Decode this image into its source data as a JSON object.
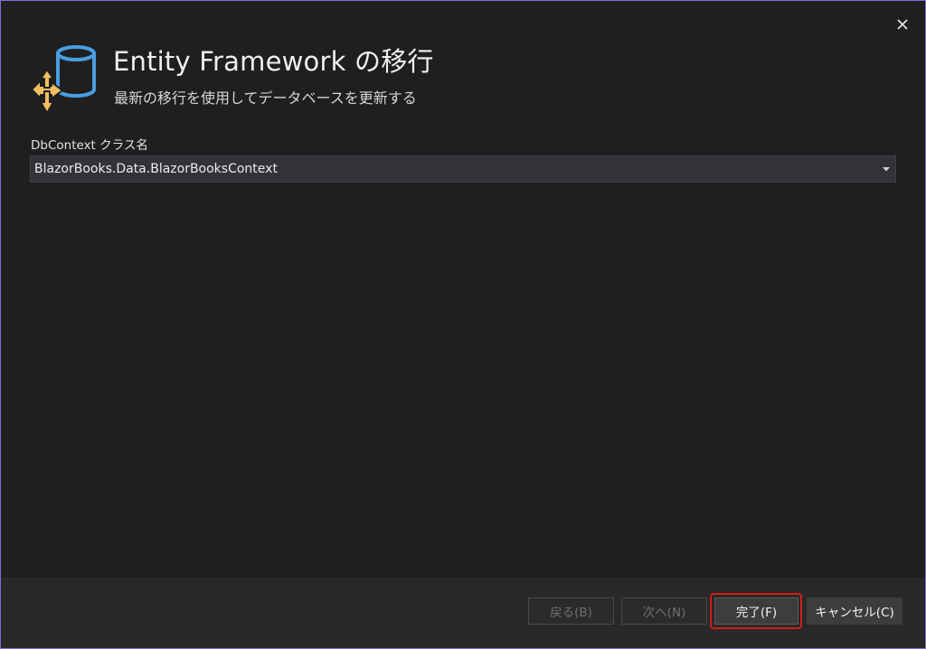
{
  "dialog": {
    "title": "Entity Framework の移行",
    "subtitle": "最新の移行を使用してデータベースを更新する",
    "close_icon": "close-icon",
    "header_icon": "database-migration-icon"
  },
  "form": {
    "dbcontext_label": "DbContext クラス名",
    "dbcontext_value": "BlazorBooks.Data.BlazorBooksContext"
  },
  "footer": {
    "back_label": "戻る(B)",
    "next_label": "次へ(N)",
    "finish_label": "完了(F)",
    "cancel_label": "キャンセル(C)"
  },
  "colors": {
    "dialog_bg": "#1f1f1f",
    "footer_bg": "#292929",
    "db_icon": "#4a9ee0",
    "arrow_icon": "#f0c060",
    "highlight": "#d11c1c"
  }
}
